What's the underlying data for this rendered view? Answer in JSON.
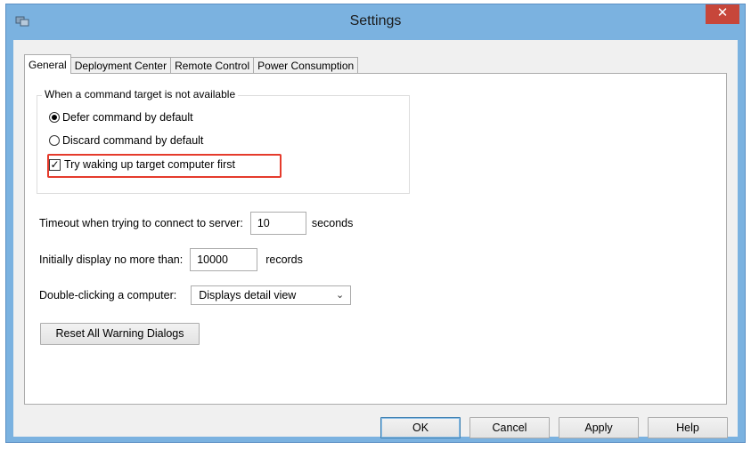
{
  "window": {
    "title": "Settings",
    "close_glyph": "✕",
    "app_icon": "app-icon"
  },
  "tabs": [
    {
      "label": "General",
      "active": true
    },
    {
      "label": "Deployment Center",
      "active": false
    },
    {
      "label": "Remote Control",
      "active": false
    },
    {
      "label": "Power Consumption",
      "active": false
    }
  ],
  "general": {
    "group": {
      "legend": "When a command target is not available",
      "defer_label": "Defer command by default",
      "defer_selected": true,
      "discard_label": "Discard command by default",
      "discard_selected": false,
      "wake_label": "Try waking up target computer first",
      "wake_checked": true
    },
    "timeout": {
      "label": "Timeout when trying to connect to server:",
      "value": "10",
      "unit": "seconds"
    },
    "display_limit": {
      "label": "Initially display no more than:",
      "value": "10000",
      "unit": "records"
    },
    "double_click": {
      "label": "Double-clicking a computer:",
      "selected": "Displays detail view"
    },
    "reset_button": "Reset All Warning Dialogs"
  },
  "footer": {
    "ok": "OK",
    "cancel": "Cancel",
    "apply": "Apply",
    "help": "Help"
  },
  "colors": {
    "frame": "#7bb2e0",
    "close": "#c7463a",
    "highlight": "#e53b2c"
  }
}
